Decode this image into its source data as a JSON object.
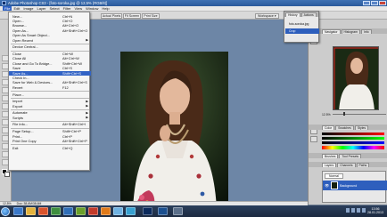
{
  "window": {
    "title": "Adobe Photoshop CS3 - [foto-soroka.jpg @ 12,5% (RGB/8)]"
  },
  "menubar": [
    "File",
    "Edit",
    "Image",
    "Layer",
    "Select",
    "Filter",
    "View",
    "Window",
    "Help"
  ],
  "options_bar": {
    "actual_pixels": "Actual Pixels",
    "fit_screen": "Fit Screen",
    "print_size": "Print Size",
    "workspace": "Workspace ▾"
  },
  "file_menu": [
    {
      "label": "New...",
      "shortcut": "Ctrl+N"
    },
    {
      "label": "Open...",
      "shortcut": "Ctrl+O"
    },
    {
      "label": "Browse...",
      "shortcut": "Alt+Ctrl+O"
    },
    {
      "label": "Open As...",
      "shortcut": "Alt+Shift+Ctrl+O"
    },
    {
      "label": "Open As Smart Object..."
    },
    {
      "label": "Open Recent",
      "submenu": true
    },
    {
      "sep": true
    },
    {
      "label": "Device Central..."
    },
    {
      "sep": true
    },
    {
      "label": "Close",
      "shortcut": "Ctrl+W"
    },
    {
      "label": "Close All",
      "shortcut": "Alt+Ctrl+W"
    },
    {
      "label": "Close and Go To Bridge...",
      "shortcut": "Shift+Ctrl+W"
    },
    {
      "label": "Save",
      "shortcut": "Ctrl+S"
    },
    {
      "label": "Save As...",
      "shortcut": "Shift+Ctrl+S",
      "highlighted": true
    },
    {
      "label": "Check In..."
    },
    {
      "label": "Save for Web & Devices...",
      "shortcut": "Alt+Shift+Ctrl+S"
    },
    {
      "label": "Revert",
      "shortcut": "F12"
    },
    {
      "sep": true
    },
    {
      "label": "Place..."
    },
    {
      "sep": true
    },
    {
      "label": "Import",
      "submenu": true
    },
    {
      "label": "Export",
      "submenu": true
    },
    {
      "sep": true
    },
    {
      "label": "Automate",
      "submenu": true
    },
    {
      "label": "Scripts",
      "submenu": true
    },
    {
      "sep": true
    },
    {
      "label": "File Info...",
      "shortcut": "Alt+Shift+Ctrl+I"
    },
    {
      "sep": true
    },
    {
      "label": "Page Setup...",
      "shortcut": "Shift+Ctrl+P"
    },
    {
      "label": "Print...",
      "shortcut": "Ctrl+P"
    },
    {
      "label": "Print One Copy",
      "shortcut": "Alt+Shift+Ctrl+P"
    },
    {
      "sep": true
    },
    {
      "label": "Exit",
      "shortcut": "Ctrl+Q"
    }
  ],
  "history_panel": {
    "tabs": [
      "History",
      "Actions"
    ],
    "items": [
      "foto-soroka.jpg",
      "Crop"
    ],
    "selected": 1
  },
  "navigator_panel": {
    "tabs": [
      "Navigator",
      "Histogram",
      "Info"
    ],
    "zoom": "12.5%"
  },
  "color_panel": {
    "tabs": [
      "Color",
      "Swatches",
      "Styles"
    ],
    "channels": [
      "R",
      "G",
      "B"
    ]
  },
  "adjust_panel": {
    "tabs": [
      "Brushes",
      "Tool Presets"
    ]
  },
  "layers_panel": {
    "tabs": [
      "Layers",
      "Channels",
      "Paths"
    ],
    "blend": "Normal",
    "layer_name": "Background"
  },
  "status_bar": {
    "zoom": "12,5%",
    "doc": "Doc: 38,6M/38,6M"
  },
  "taskbar": {
    "time": "13:56",
    "date": "28.01.2013"
  },
  "colors": {
    "accent": "#3163c5",
    "canvas_bg": "#6d86a6",
    "taskbar": "#1c2a40"
  }
}
